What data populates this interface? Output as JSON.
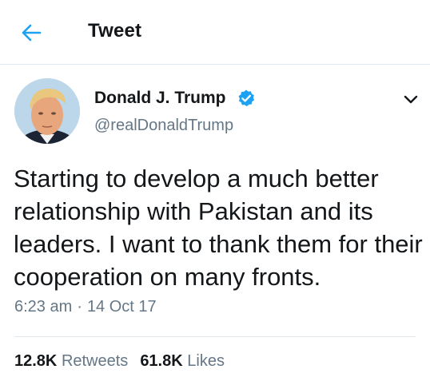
{
  "header": {
    "title": "Tweet",
    "back_icon": "arrow-left-icon",
    "accent_color": "#1da1f2"
  },
  "tweet": {
    "author_name": "Donald J. Trump",
    "verified_icon": "verified-badge-icon",
    "handle": "@realDonaldTrump",
    "menu_icon": "chevron-down-icon",
    "text": "Starting to develop a much better relationship with Pakistan and its leaders. I want to thank them for their cooperation on many fronts.",
    "time": "6:23 am",
    "separator": "·",
    "date": "14 Oct 17"
  },
  "stats": {
    "retweets_count": "12.8K",
    "retweets_label": "Retweets",
    "likes_count": "61.8K",
    "likes_label": "Likes"
  },
  "colors": {
    "text": "#14171a",
    "secondary": "#657786",
    "border": "#e1e8ed",
    "verified": "#1da1f2"
  }
}
